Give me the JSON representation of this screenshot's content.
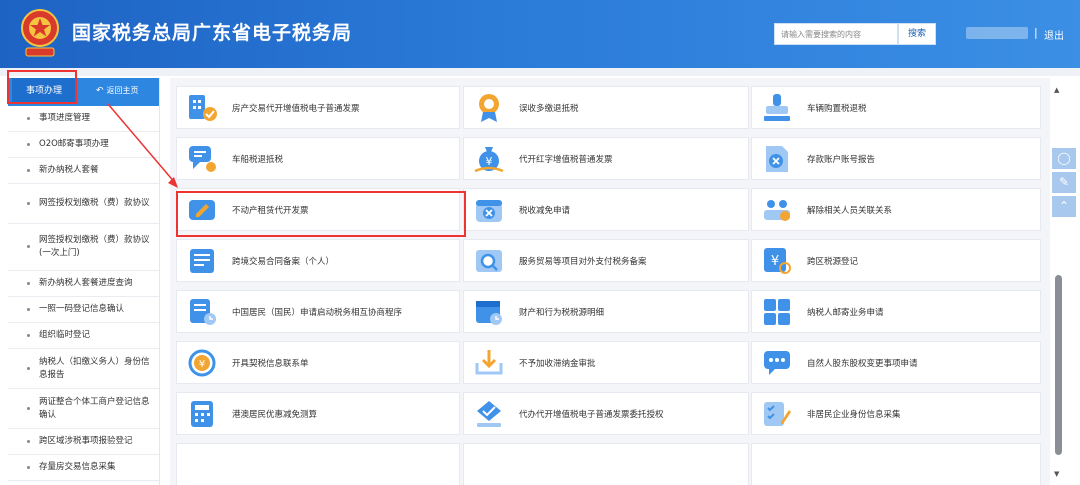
{
  "header": {
    "title": "国家税务总局广东省电子税务局",
    "search_placeholder": "请输入需要搜索的内容",
    "search_button": "搜索",
    "separator": "|",
    "logout": "退出"
  },
  "sidebar": {
    "tab": "事项办理",
    "home": "返回主页",
    "items": [
      "事项进度管理",
      "O2O邮寄事项办理",
      "新办纳税人套餐",
      "网签授权划缴税（费）款协议",
      "网签授权划缴税（费）款协议(一次上门)",
      "新办纳税人套餐进度查询",
      "一照一码登记信息确认",
      "组织临时登记",
      "纳税人（扣缴义务人）身份信息报告",
      "两证整合个体工商户登记信息确认",
      "跨区域涉税事项报验登记",
      "存量房交易信息采集"
    ]
  },
  "services": [
    "房产交易代开增值税电子普通发票",
    "误收多缴退抵税",
    "车辆购置税退税",
    "车船税退抵税",
    "代开红字增值税普通发票",
    "存款账户账号报告",
    "不动产租赁代开发票",
    "税收减免申请",
    "解除相关人员关联关系",
    "跨境交易合同备案（个人）",
    "服务贸易等项目对外支付税务备案",
    "跨区税源登记",
    "中国居民（国民）申请启动税务相互协商程序",
    "财产和行为税税源明细",
    "纳税人邮寄业务申请",
    "开具契税信息联系单",
    "不予加收滞纳金审批",
    "自然人股东股权变更事项申请",
    "港澳居民优惠减免测算",
    "代办代开增值税电子普通发票委托授权",
    "非居民企业身份信息采集"
  ],
  "colors": {
    "header": "#2a7ad8",
    "accent": "#3f92e8",
    "highlight": "#e33333"
  }
}
